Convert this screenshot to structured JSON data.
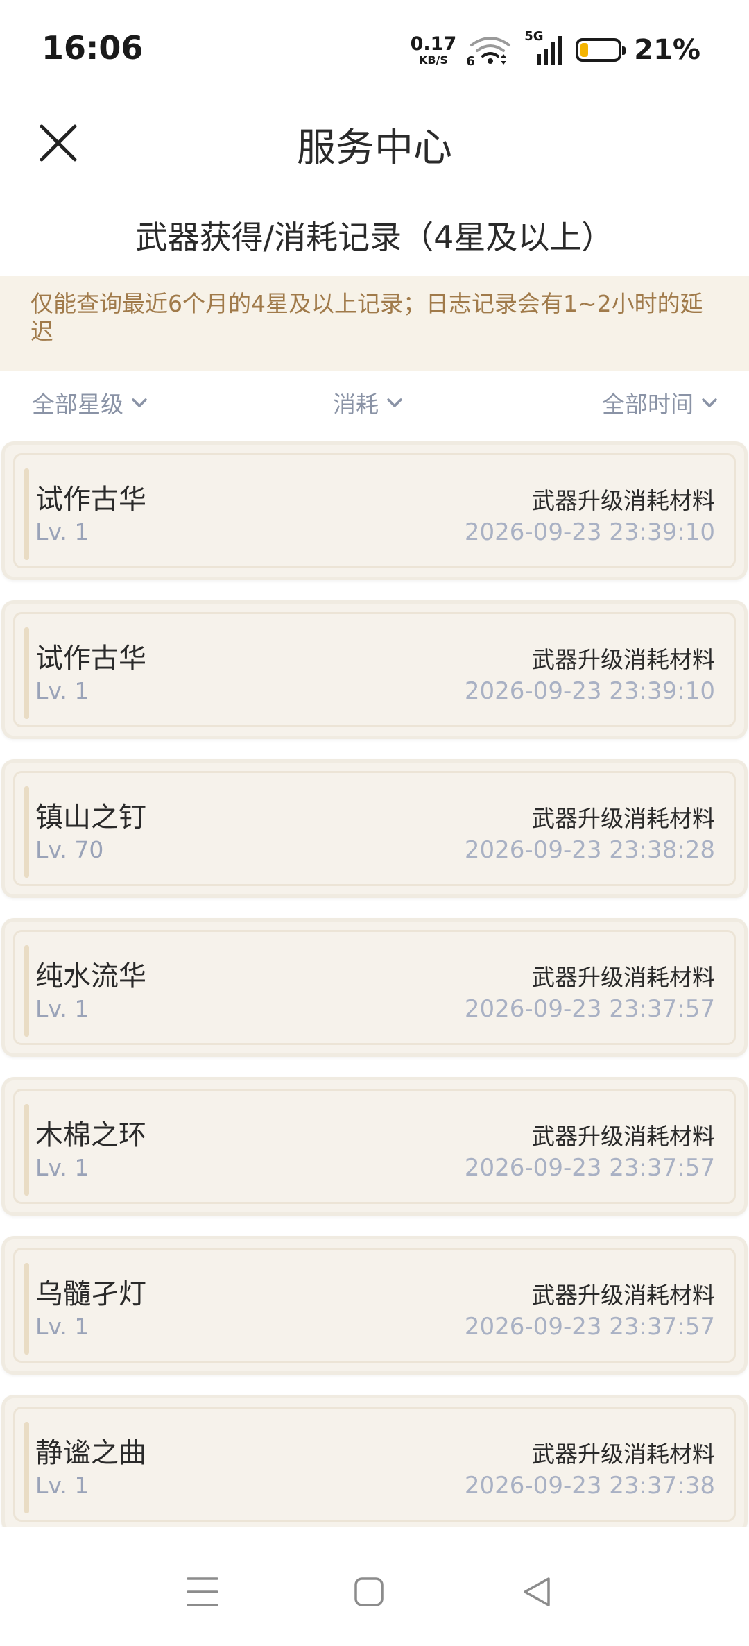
{
  "status_bar": {
    "time": "16:06",
    "net_speed_value": "0.17",
    "net_speed_unit": "KB/S",
    "wifi_label": "6",
    "signal_label": "5G",
    "battery_percent": "21%",
    "battery_level": 0.21,
    "battery_color": "#f4b400"
  },
  "header": {
    "title": "服务中心",
    "subtitle": "武器获得/消耗记录（4星及以上）"
  },
  "notice": {
    "text": "仅能查询最近6个月的4星及以上记录；日志记录会有1~2小时的延迟"
  },
  "filters": {
    "star": "全部星级",
    "type": "消耗",
    "time": "全部时间"
  },
  "records": [
    {
      "name": "试作古华",
      "level": "Lv. 1",
      "reason": "武器升级消耗材料",
      "time": "2026-09-23 23:39:10"
    },
    {
      "name": "试作古华",
      "level": "Lv. 1",
      "reason": "武器升级消耗材料",
      "time": "2026-09-23 23:39:10"
    },
    {
      "name": "镇山之钉",
      "level": "Lv. 70",
      "reason": "武器升级消耗材料",
      "time": "2026-09-23 23:38:28"
    },
    {
      "name": "纯水流华",
      "level": "Lv. 1",
      "reason": "武器升级消耗材料",
      "time": "2026-09-23 23:37:57"
    },
    {
      "name": "木棉之环",
      "level": "Lv. 1",
      "reason": "武器升级消耗材料",
      "time": "2026-09-23 23:37:57"
    },
    {
      "name": "乌髓孑灯",
      "level": "Lv. 1",
      "reason": "武器升级消耗材料",
      "time": "2026-09-23 23:37:57"
    },
    {
      "name": "静谧之曲",
      "level": "Lv. 1",
      "reason": "武器升级消耗材料",
      "time": "2026-09-23 23:37:38"
    }
  ],
  "icons": {
    "close": "close-icon",
    "chevron": "chevron-down-icon",
    "nav_menu": "menu-icon",
    "nav_home": "home-icon",
    "nav_back": "back-icon"
  }
}
